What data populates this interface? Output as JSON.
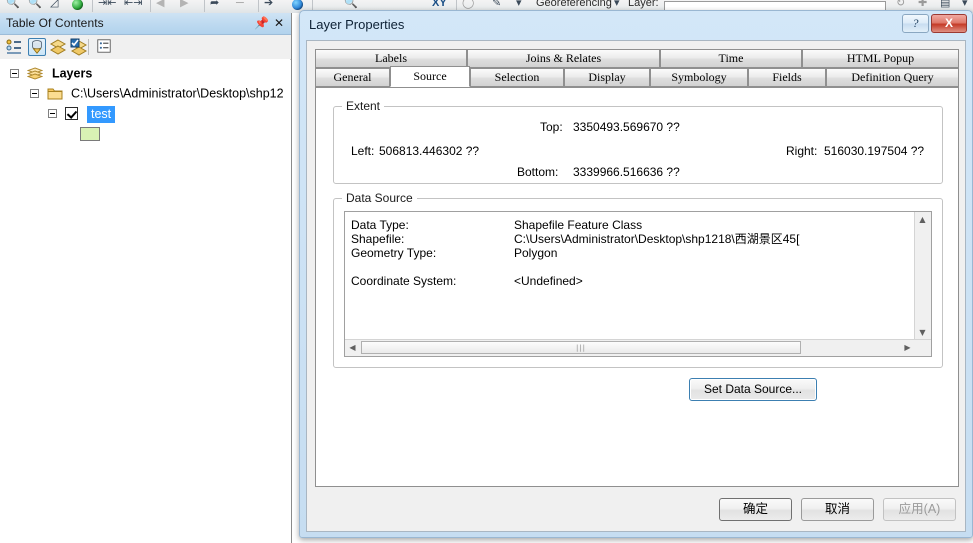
{
  "app": {
    "toolbar": {
      "georeferencing_label": "Georeferencing",
      "layer_label": "Layer:",
      "layer_value": ""
    }
  },
  "toc": {
    "title": "Table Of Contents",
    "pin_icon": "pin-icon",
    "close_icon": "close-icon",
    "toolbar_buttons": [
      {
        "name": "list-by-drawing-order-icon",
        "label": "List By Drawing Order",
        "selected": false
      },
      {
        "name": "list-by-source-icon",
        "label": "List By Source",
        "selected": true
      },
      {
        "name": "list-by-visibility-icon",
        "label": "List By Visibility",
        "selected": false
      },
      {
        "name": "list-by-selection-icon",
        "label": "List By Selection",
        "selected": false
      },
      {
        "name": "options-icon",
        "label": "Options",
        "selected": false
      }
    ],
    "tree": {
      "root_label": "Layers",
      "folder_label": "C:\\Users\\Administrator\\Desktop\\shp12",
      "layer_label": "test",
      "layer_checked": true,
      "symbol_color": "#d9f2b4"
    }
  },
  "dialog": {
    "title": "Layer Properties",
    "help_label": "?",
    "close_label": "X",
    "tabs_row1": [
      {
        "label": "Labels",
        "active": false
      },
      {
        "label": "Joins & Relates",
        "active": false
      },
      {
        "label": "Time",
        "active": false
      },
      {
        "label": "HTML Popup",
        "active": false
      }
    ],
    "tabs_row2": [
      {
        "label": "General",
        "active": false
      },
      {
        "label": "Source",
        "active": true
      },
      {
        "label": "Selection",
        "active": false
      },
      {
        "label": "Display",
        "active": false
      },
      {
        "label": "Symbology",
        "active": false
      },
      {
        "label": "Fields",
        "active": false
      },
      {
        "label": "Definition Query",
        "active": false
      }
    ],
    "extent": {
      "title": "Extent",
      "top_label": "Top:",
      "top_value": "3350493.569670 ??",
      "left_label": "Left:",
      "left_value": "506813.446302 ??",
      "right_label": "Right:",
      "right_value": "516030.197504 ??",
      "bottom_label": "Bottom:",
      "bottom_value": "3339966.516636 ??"
    },
    "data_source": {
      "title": "Data Source",
      "rows": [
        {
          "key": "Data Type:",
          "value": "Shapefile Feature Class"
        },
        {
          "key": "Shapefile:",
          "value": "C:\\Users\\Administrator\\Desktop\\shp1218\\西湖景区45["
        },
        {
          "key": "Geometry Type:",
          "value": "Polygon"
        },
        {
          "key": "",
          "value": ""
        },
        {
          "key": "Coordinate System:",
          "value": "<Undefined>"
        }
      ],
      "set_data_source_label": "Set Data Source..."
    },
    "buttons": {
      "ok_label": "确定",
      "cancel_label": "取消",
      "apply_label": "应用(A)",
      "apply_disabled": true
    }
  },
  "colors": {
    "titlebar_blue": "#c6ddf1",
    "selection_blue": "#3399ff",
    "accent_border": "#3c7fb1",
    "close_red": "#c53b28"
  }
}
